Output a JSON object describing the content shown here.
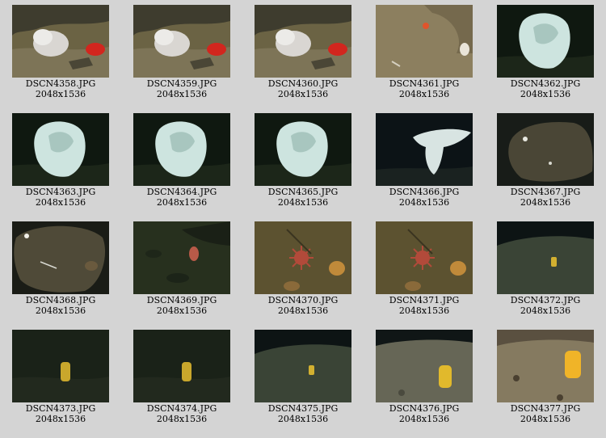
{
  "gallery": {
    "items": [
      {
        "filename": "DSCN4358.JPG",
        "dimensions": "2048x1536",
        "scene": "rock-white-coral-red-anemone"
      },
      {
        "filename": "DSCN4359.JPG",
        "dimensions": "2048x1536",
        "scene": "rock-white-coral-red-anemone"
      },
      {
        "filename": "DSCN4360.JPG",
        "dimensions": "2048x1536",
        "scene": "rock-white-coral-red-anemone"
      },
      {
        "filename": "DSCN4361.JPG",
        "dimensions": "2048x1536",
        "scene": "sand-small-starfish"
      },
      {
        "filename": "DSCN4362.JPG",
        "dimensions": "2048x1536",
        "scene": "white-glass-sponge"
      },
      {
        "filename": "DSCN4363.JPG",
        "dimensions": "2048x1536",
        "scene": "white-glass-sponge"
      },
      {
        "filename": "DSCN4364.JPG",
        "dimensions": "2048x1536",
        "scene": "white-glass-sponge"
      },
      {
        "filename": "DSCN4365.JPG",
        "dimensions": "2048x1536",
        "scene": "white-glass-sponge"
      },
      {
        "filename": "DSCN4366.JPG",
        "dimensions": "2048x1536",
        "scene": "white-vase-sponge"
      },
      {
        "filename": "DSCN4367.JPG",
        "dimensions": "2048x1536",
        "scene": "dark-boulder"
      },
      {
        "filename": "DSCN4368.JPG",
        "dimensions": "2048x1536",
        "scene": "dark-boulder-left"
      },
      {
        "filename": "DSCN4369.JPG",
        "dimensions": "2048x1536",
        "scene": "rocky-seafloor-fish"
      },
      {
        "filename": "DSCN4370.JPG",
        "dimensions": "2048x1536",
        "scene": "red-sea-star"
      },
      {
        "filename": "DSCN4371.JPG",
        "dimensions": "2048x1536",
        "scene": "red-sea-star"
      },
      {
        "filename": "DSCN4372.JPG",
        "dimensions": "2048x1536",
        "scene": "slope-yellow-sponge-small"
      },
      {
        "filename": "DSCN4373.JPG",
        "dimensions": "2048x1536",
        "scene": "dark-yellow-sponge"
      },
      {
        "filename": "DSCN4374.JPG",
        "dimensions": "2048x1536",
        "scene": "dark-yellow-sponge"
      },
      {
        "filename": "DSCN4375.JPG",
        "dimensions": "2048x1536",
        "scene": "slope-yellow-sponge-small"
      },
      {
        "filename": "DSCN4376.JPG",
        "dimensions": "2048x1536",
        "scene": "slope-yellow-sponge-big"
      },
      {
        "filename": "DSCN4377.JPG",
        "dimensions": "2048x1536",
        "scene": "bright-yellow-sponge"
      }
    ]
  }
}
